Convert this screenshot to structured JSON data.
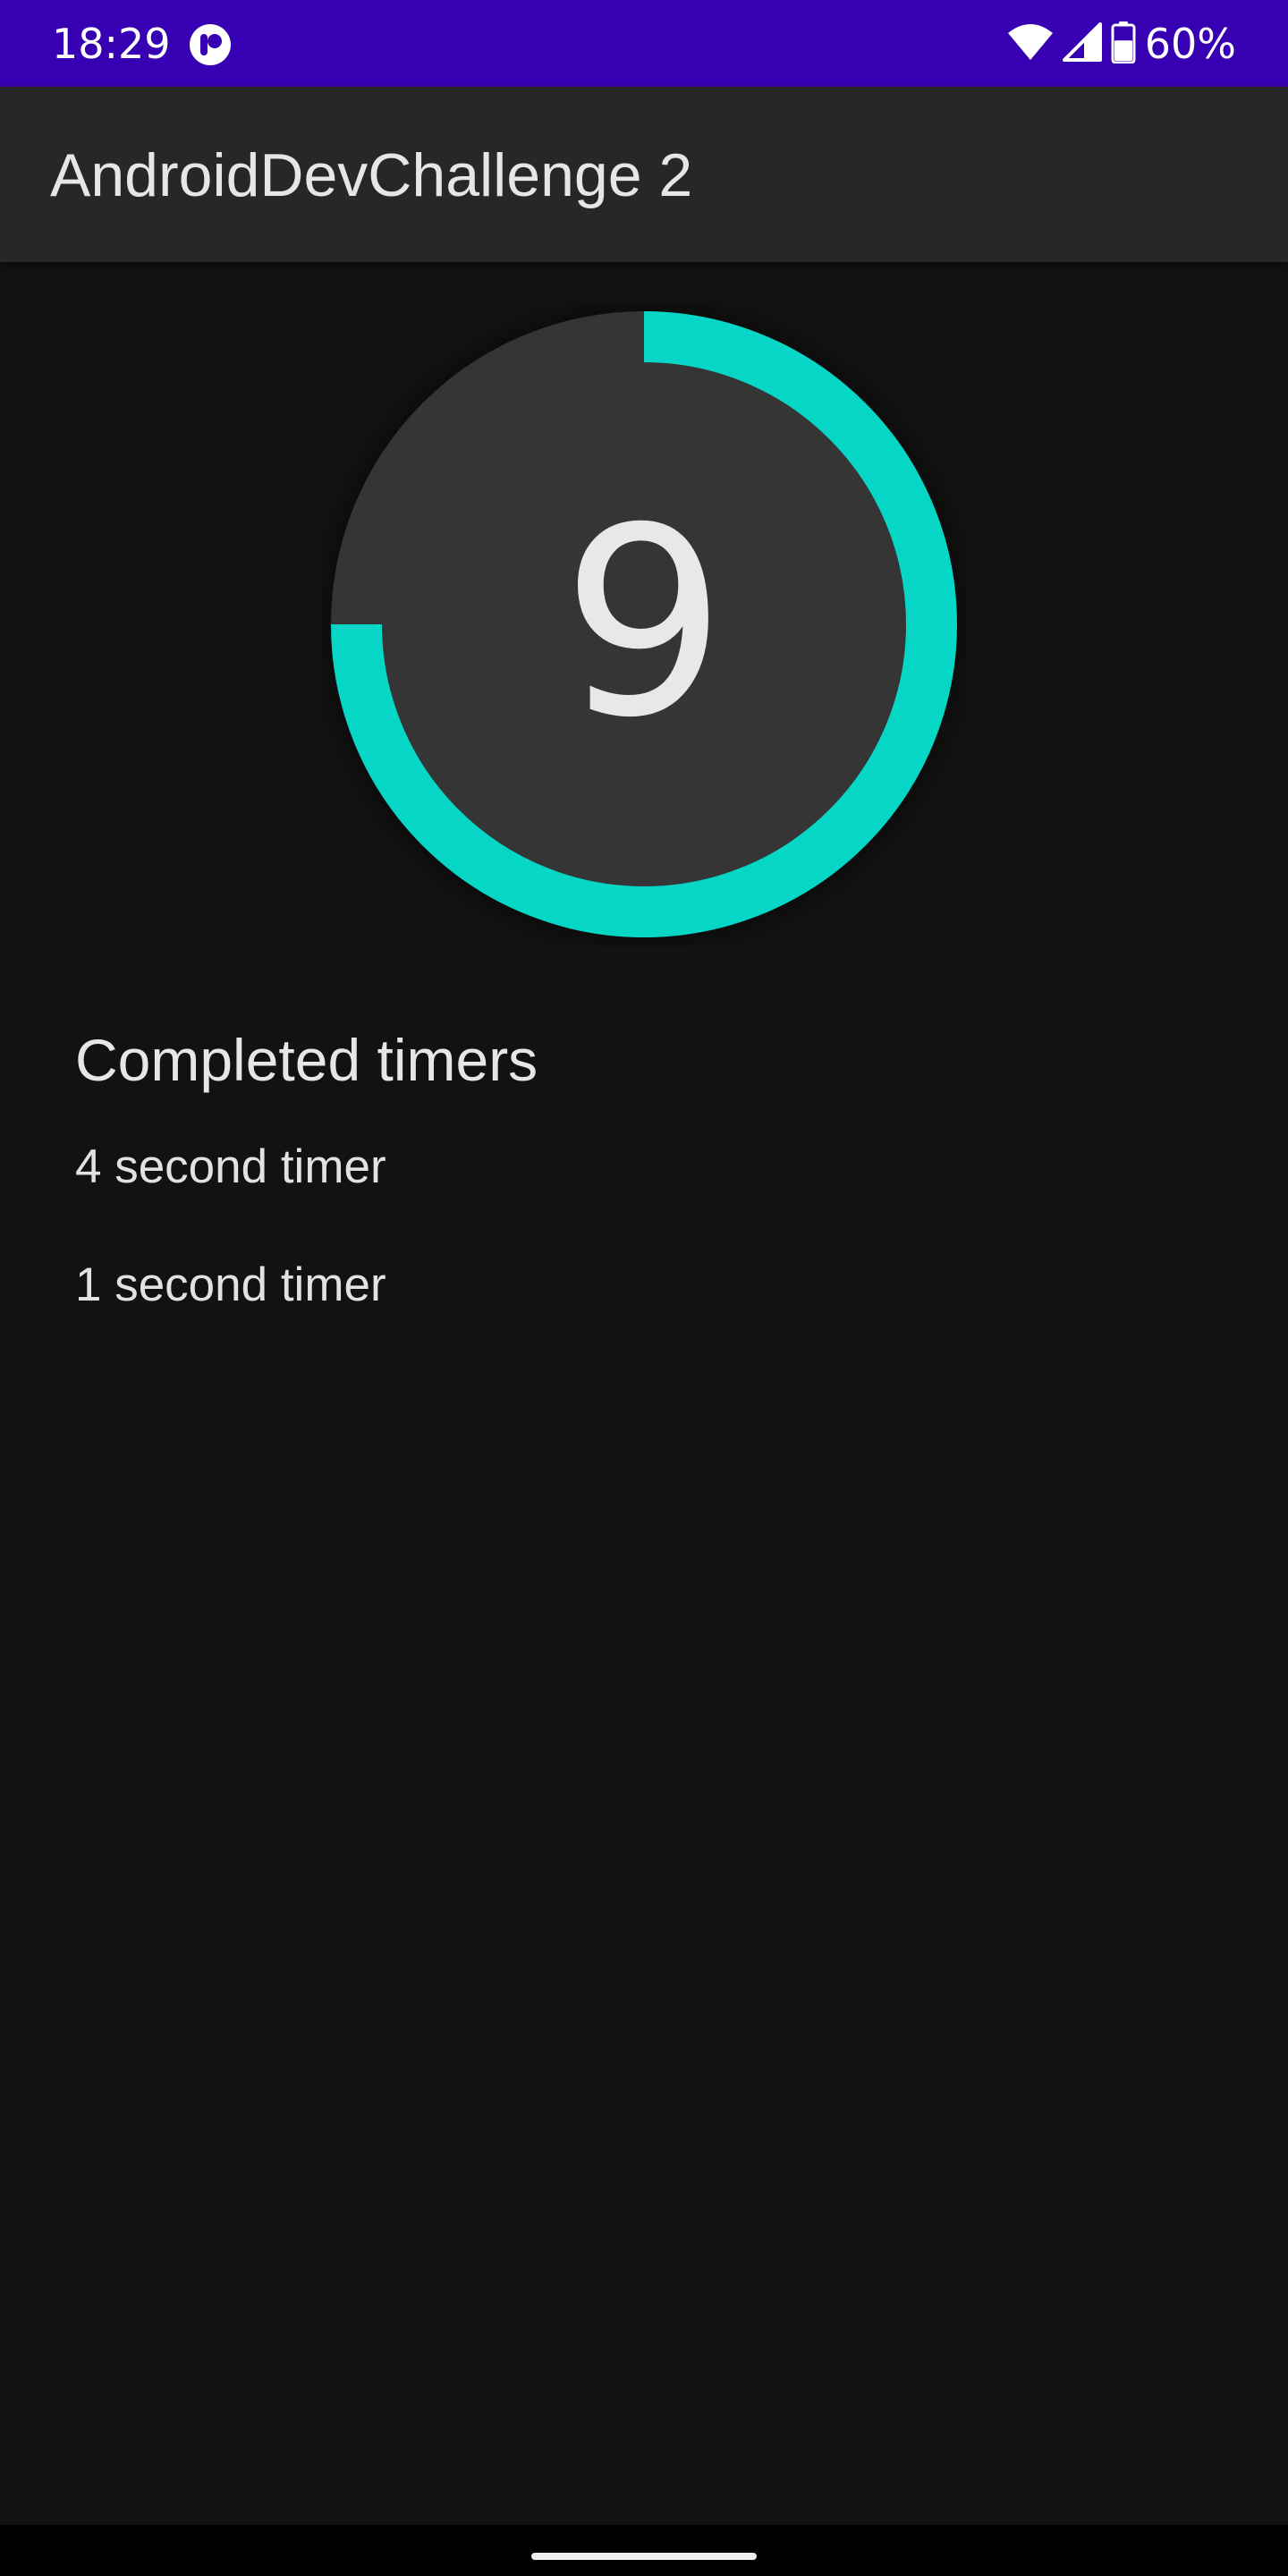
{
  "status_bar": {
    "time": "18:29",
    "battery_percent": "60%",
    "battery_level": 0.6,
    "background_color": "#3700B3",
    "icons": [
      "app-notification-icon",
      "wifi-icon",
      "cellular-signal-icon",
      "battery-icon"
    ]
  },
  "app_bar": {
    "title": "AndroidDevChallenge 2"
  },
  "timer": {
    "value": "9",
    "remaining_fraction": 0.75,
    "progress_color": "#06D6C6",
    "track_color": "#353535"
  },
  "completed": {
    "title": "Completed timers",
    "items": [
      {
        "label": "4 second timer"
      },
      {
        "label": "1 second timer"
      }
    ]
  }
}
